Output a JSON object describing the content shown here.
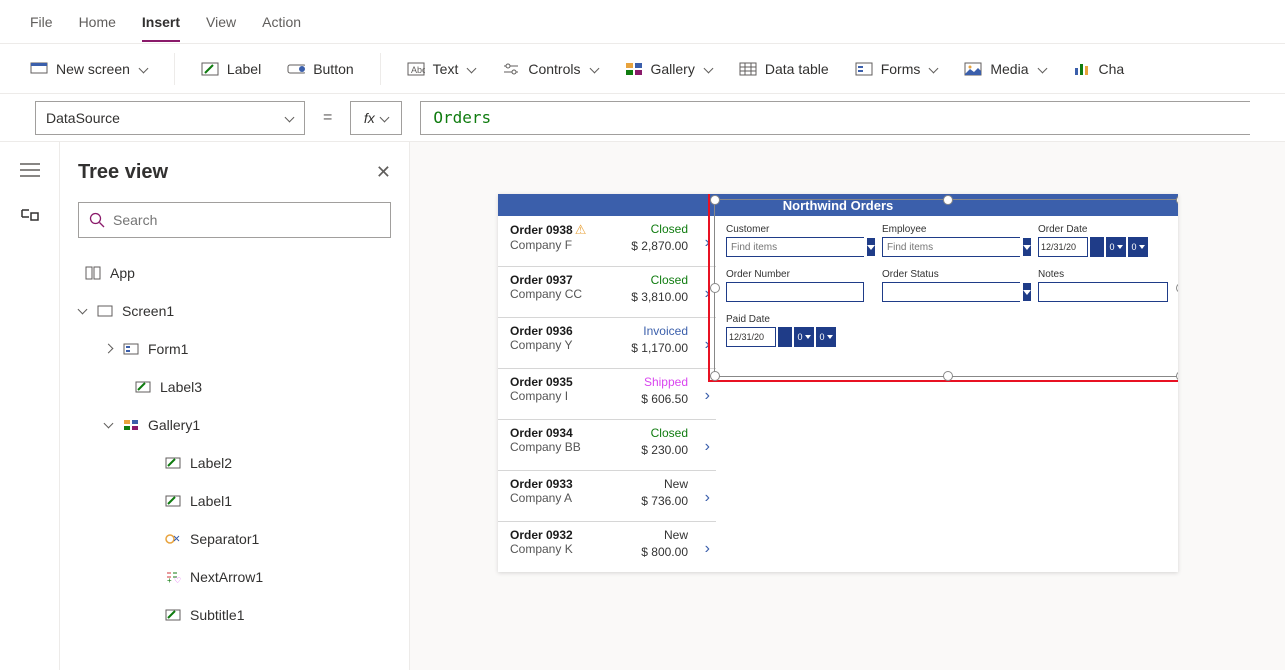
{
  "menubar": {
    "items": [
      "File",
      "Home",
      "Insert",
      "View",
      "Action"
    ],
    "active_index": 2
  },
  "ribbon": {
    "new_screen": "New screen",
    "label": "Label",
    "button": "Button",
    "text": "Text",
    "controls": "Controls",
    "gallery": "Gallery",
    "data_table": "Data table",
    "forms": "Forms",
    "media": "Media",
    "chart": "Cha"
  },
  "property_selector": "DataSource",
  "equals": "=",
  "fx": "fx",
  "formula": "Orders",
  "tree": {
    "title": "Tree view",
    "search_placeholder": "Search",
    "nodes": {
      "app": "App",
      "screen1": "Screen1",
      "form1": "Form1",
      "label3": "Label3",
      "gallery1": "Gallery1",
      "label2": "Label2",
      "label1": "Label1",
      "separator1": "Separator1",
      "nextarrow1": "NextArrow1",
      "subtitle1": "Subtitle1"
    }
  },
  "canvasApp": {
    "title": "Northwind Orders",
    "gallery_rows": [
      {
        "order": "Order 0938",
        "warn": true,
        "company": "Company F",
        "status": "Closed",
        "amount": "$ 2,870.00"
      },
      {
        "order": "Order 0937",
        "warn": false,
        "company": "Company CC",
        "status": "Closed",
        "amount": "$ 3,810.00"
      },
      {
        "order": "Order 0936",
        "warn": false,
        "company": "Company Y",
        "status": "Invoiced",
        "amount": "$ 1,170.00"
      },
      {
        "order": "Order 0935",
        "warn": false,
        "company": "Company I",
        "status": "Shipped",
        "amount": "$ 606.50"
      },
      {
        "order": "Order 0934",
        "warn": false,
        "company": "Company BB",
        "status": "Closed",
        "amount": "$ 230.00"
      },
      {
        "order": "Order 0933",
        "warn": false,
        "company": "Company A",
        "status": "New",
        "amount": "$ 736.00"
      },
      {
        "order": "Order 0932",
        "warn": false,
        "company": "Company K",
        "status": "New",
        "amount": "$ 800.00"
      }
    ],
    "form_fields": {
      "customer_label": "Customer",
      "customer_placeholder": "Find items",
      "employee_label": "Employee",
      "employee_placeholder": "Find items",
      "order_date_label": "Order Date",
      "order_date_value": "12/31/20",
      "order_number_label": "Order Number",
      "order_status_label": "Order Status",
      "notes_label": "Notes",
      "paid_date_label": "Paid Date",
      "paid_date_value": "12/31/20",
      "spin_zero": "0"
    }
  }
}
